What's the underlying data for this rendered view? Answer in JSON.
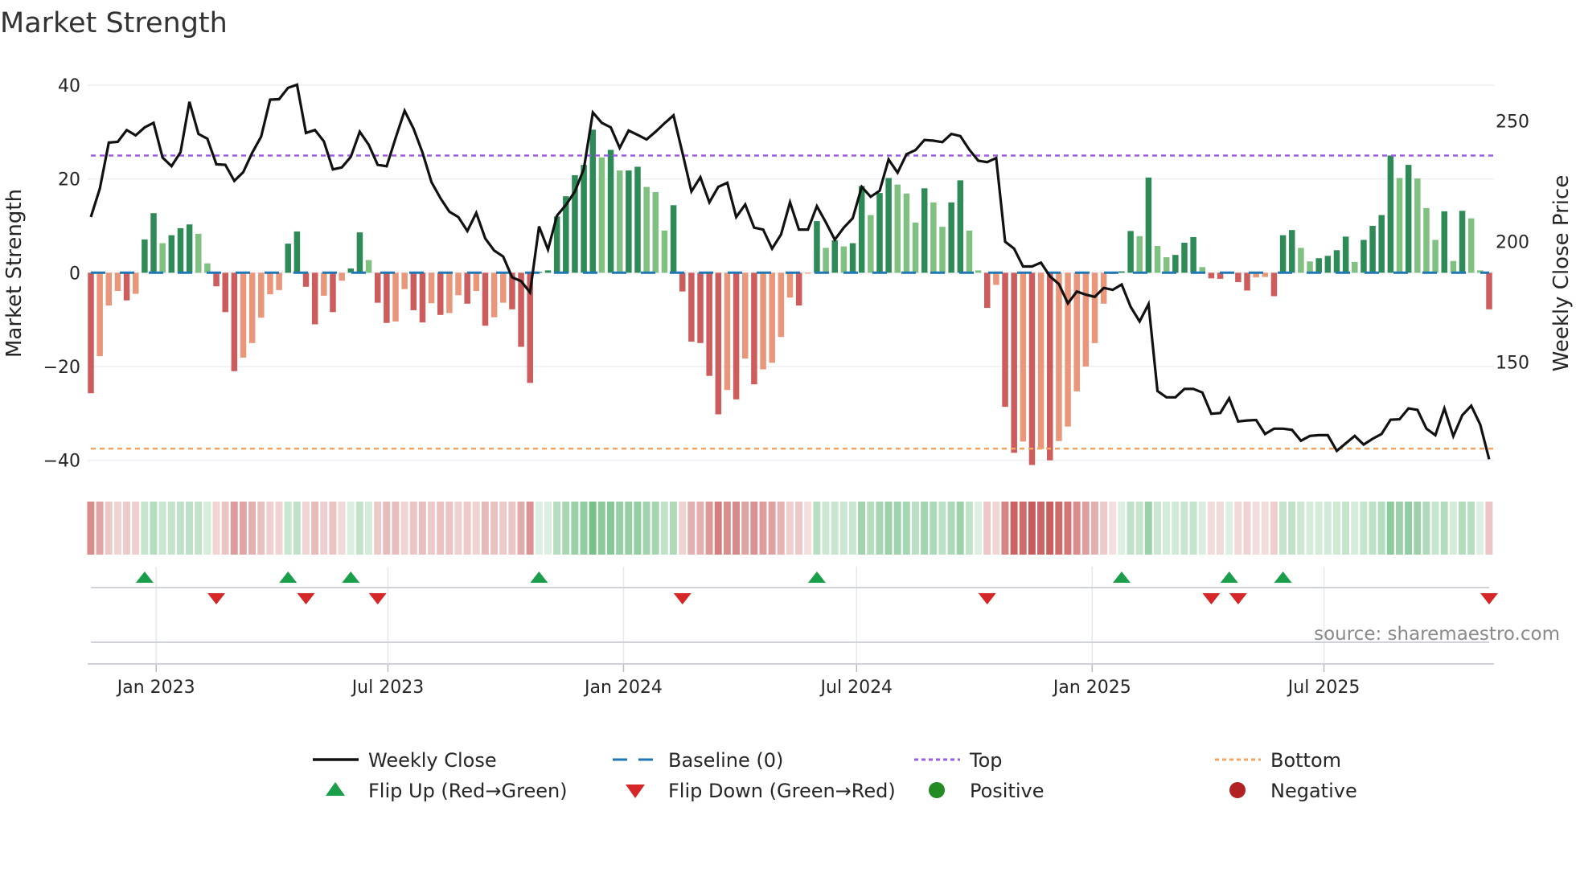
{
  "chart_data": {
    "type": "bar+line",
    "title": "Market Strength",
    "ylabel": "Market Strength",
    "y2label": "Weekly Close Price",
    "ylim": [
      -44,
      44
    ],
    "y2lim": [
      101.5,
      272.7
    ],
    "yticks": [
      40,
      20,
      0,
      -20,
      -40
    ],
    "ytick_labels": [
      "40",
      "20",
      "0",
      "−20",
      "−40"
    ],
    "y2ticks": [
      250,
      200,
      150
    ],
    "y2tick_labels": [
      "250",
      "200",
      "150"
    ],
    "grid": true,
    "frequency": "weekly",
    "start_week": "2022-11-11",
    "xticks": [
      {
        "label": "Jan 2023",
        "date": "2023-01-01"
      },
      {
        "label": "Jul 2023",
        "date": "2023-07-01"
      },
      {
        "label": "Jan 2024",
        "date": "2024-01-01"
      },
      {
        "label": "Jul 2024",
        "date": "2024-07-01"
      },
      {
        "label": "Jan 2025",
        "date": "2025-01-01"
      },
      {
        "label": "Jul 2025",
        "date": "2025-07-01"
      }
    ],
    "top_level": 25,
    "bottom_level": -37.5,
    "baseline": 0,
    "strength": [
      -25.7,
      -17.8,
      -7,
      -3.9,
      -5.9,
      -4.5,
      7.1,
      12.7,
      6.3,
      8,
      9.5,
      10.3,
      8.3,
      2,
      -2.9,
      -8.4,
      -21,
      -18.1,
      -15,
      -9.6,
      -4.6,
      -3.7,
      6.2,
      8.8,
      -3,
      -11,
      -4.9,
      -8.4,
      -1.7,
      0.9,
      8.6,
      2.7,
      -6.4,
      -10.7,
      -10.4,
      -3.5,
      -8,
      -10.6,
      -6.5,
      -9,
      -8.6,
      -4.8,
      -6.6,
      -3.9,
      -11.3,
      -9.5,
      -6.4,
      -7.8,
      -15.8,
      -23.5,
      0.2,
      0.5,
      12,
      16.3,
      20.8,
      23,
      30.5,
      24.6,
      26.2,
      21.8,
      21.8,
      22.6,
      18.3,
      17.2,
      9,
      14.4,
      -4,
      -14.7,
      -15,
      -22,
      -30.2,
      -25,
      -27,
      -18.3,
      -23.8,
      -20.6,
      -19.2,
      -13.7,
      -5.3,
      -7,
      -0.2,
      11,
      5.3,
      6.9,
      5.6,
      6.3,
      18.5,
      12.3,
      17,
      20.2,
      18.8,
      16.9,
      10.7,
      18,
      15,
      9.8,
      15,
      19.7,
      9,
      0.5,
      -7.5,
      -2.6,
      -28.6,
      -38.4,
      -36,
      -41,
      -37.6,
      -40,
      -35.9,
      -32.8,
      -25.3,
      -20,
      -15,
      -6.6,
      -0.3,
      0.3,
      8.9,
      7.8,
      20.3,
      5.7,
      3.3,
      3.8,
      6.4,
      7.6,
      1.2,
      -1.2,
      -1.3,
      0.2,
      -2,
      -3.8,
      -1,
      -0.9,
      -5,
      8,
      9.1,
      5.3,
      2.4,
      3.1,
      3.6,
      4.8,
      7.7,
      2.3,
      7,
      10,
      12.3,
      25,
      20.2,
      23,
      20.1,
      13.8,
      7,
      13.1,
      2.5,
      13.2,
      11.6,
      0.5,
      -7.8
    ],
    "weekly_close": [
      210.2,
      221.9,
      241.1,
      241.4,
      246.3,
      244.1,
      247.4,
      249.3,
      234.9,
      231.3,
      237.1,
      258,
      244.7,
      242.7,
      232.1,
      231.9,
      225.2,
      228.8,
      236.9,
      243.6,
      258.9,
      259.1,
      263.8,
      265.1,
      245.1,
      246.3,
      241.6,
      230,
      230.8,
      235.2,
      245.6,
      240.2,
      231.9,
      231.3,
      243,
      254.3,
      246.9,
      236.9,
      224.7,
      218,
      212.4,
      210.2,
      204.4,
      211.9,
      201.3,
      196.3,
      193.8,
      185.2,
      183.6,
      178.9,
      206.3,
      196.7,
      210.8,
      215.2,
      220.8,
      230.2,
      253.6,
      249.3,
      247.4,
      238.9,
      246.1,
      244.3,
      242.4,
      245.6,
      249.1,
      252.4,
      236.9,
      220.8,
      226.7,
      216.3,
      222.7,
      224.4,
      210.2,
      215.4,
      205.8,
      205,
      197.1,
      203,
      216.3,
      205,
      205,
      214.7,
      208,
      200.8,
      205.8,
      209.7,
      222.7,
      218.6,
      221.1,
      234.1,
      228.6,
      236.3,
      238,
      242.2,
      241.9,
      241.3,
      244.7,
      243.8,
      238.2,
      233.6,
      233,
      234.7,
      200,
      197.1,
      189.7,
      189.7,
      191.3,
      185.6,
      182.4,
      174.4,
      179.3,
      178,
      177.1,
      180.8,
      180,
      182.2,
      173,
      166.9,
      174.1,
      138,
      135.4,
      135.4,
      138.9,
      138.9,
      137.4,
      128.6,
      128.9,
      135,
      125.4,
      125.8,
      126,
      120.2,
      122.4,
      122.4,
      121.9,
      117.4,
      119.4,
      119.7,
      119.7,
      113.2,
      116.3,
      119.4,
      115.8,
      118.2,
      120.2,
      126.1,
      126.3,
      130.8,
      130.2,
      122.4,
      119.7,
      130.8,
      119.3,
      128,
      131.9,
      124.1,
      109.7
    ],
    "flip_up_index": [
      6,
      22,
      29,
      50,
      81,
      115,
      127,
      133
    ],
    "flip_down_index": [
      14,
      24,
      32,
      66,
      100,
      125,
      128,
      156
    ],
    "legend": {
      "placement": "bottom",
      "items": [
        {
          "label": "Weekly Close",
          "kind": "line"
        },
        {
          "label": "Baseline (0)",
          "kind": "dashed"
        },
        {
          "label": "Top",
          "kind": "dotted-top"
        },
        {
          "label": "Bottom",
          "kind": "dotted-bottom"
        },
        {
          "label": "Flip Up (Red→Green)",
          "kind": "tri-up"
        },
        {
          "label": "Flip Down (Green→Red)",
          "kind": "tri-down"
        },
        {
          "label": "Positive",
          "kind": "dot-pos"
        },
        {
          "label": "Negative",
          "kind": "dot-neg"
        }
      ]
    },
    "source": "source: sharemaestro.com",
    "colors": {
      "green_dark": "#2e8b57",
      "green_light": "#80c080",
      "red_dark": "#cd5c5c",
      "red_light": "#e9967a",
      "close_line": "#111111",
      "baseline": "#1f77b4",
      "top": "#9b5de5",
      "bottom": "#f4a460",
      "flip_up": "#1a9e4a",
      "flip_down": "#d62728",
      "positive": "#228b22",
      "negative": "#b22222",
      "grid": "#eceef3"
    }
  }
}
